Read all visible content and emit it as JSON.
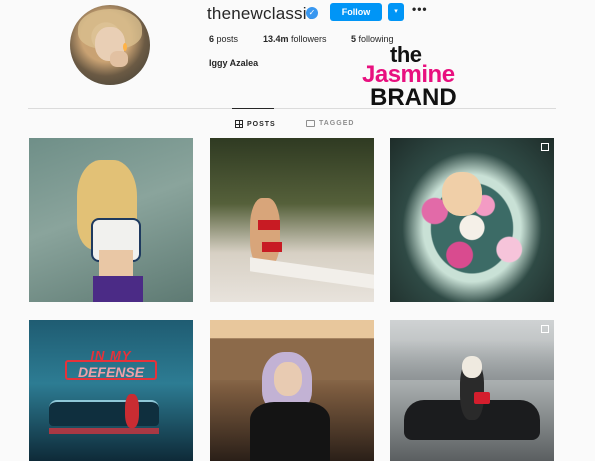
{
  "profile": {
    "username": "thenewclassic",
    "verified_glyph": "✓",
    "follow_label": "Follow",
    "dropdown_glyph": "▾",
    "more_glyph": "•••",
    "posts_count": "6",
    "posts_label": "posts",
    "followers_count": "13.4m",
    "followers_label": "followers",
    "following_count": "5",
    "following_label": "following",
    "full_name": "Iggy Azalea"
  },
  "watermark": {
    "line1": "the",
    "line2": "Jasmine",
    "line3": "BRAND"
  },
  "tabs": [
    {
      "label": "POSTS",
      "icon": "grid-icon",
      "active": true
    },
    {
      "label": "TAGGED",
      "icon": "tag-icon",
      "active": false
    }
  ],
  "posts": [
    {
      "id": "post-1"
    },
    {
      "id": "post-2"
    },
    {
      "id": "post-3"
    },
    {
      "id": "post-4",
      "overlay_line1": "IN MY",
      "overlay_line2": "DEFENSE"
    },
    {
      "id": "post-5"
    },
    {
      "id": "post-6"
    }
  ],
  "colors": {
    "accent": "#0095f6",
    "watermark_pink": "#e8107f",
    "text": "#262626",
    "muted": "#8e8e8e"
  }
}
